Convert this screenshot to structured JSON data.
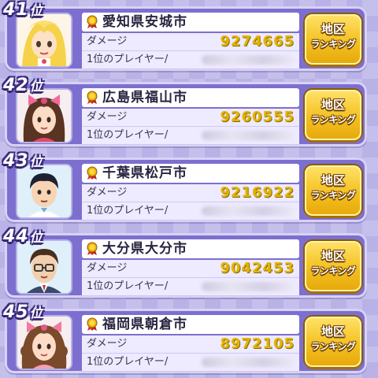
{
  "colors": {
    "background": "#b8b2e6",
    "panel": "#7d6fcf",
    "damage_value": "#e2b400",
    "button": "#f4c020"
  },
  "rankings": [
    {
      "rank_number": "41",
      "rank_suffix": "位",
      "city": "愛知県安城市",
      "damage_label": "ダメージ",
      "damage_value": "9274665",
      "top_player_label": "1位のプレイヤー/",
      "button_line1": "地区",
      "button_line2": "ランキング",
      "avatar_icon": "blonde-girl-avatar-icon"
    },
    {
      "rank_number": "42",
      "rank_suffix": "位",
      "city": "広島県福山市",
      "damage_label": "ダメージ",
      "damage_value": "9260555",
      "top_player_label": "1位のプレイヤー/",
      "button_line1": "地区",
      "button_line2": "ランキング",
      "avatar_icon": "brown-hair-girl-bow-avatar-icon"
    },
    {
      "rank_number": "43",
      "rank_suffix": "位",
      "city": "千葉県松戸市",
      "damage_label": "ダメージ",
      "damage_value": "9216922",
      "top_player_label": "1位のプレイヤー/",
      "button_line1": "地区",
      "button_line2": "ランキング",
      "avatar_icon": "dark-hair-man-avatar-icon"
    },
    {
      "rank_number": "44",
      "rank_suffix": "位",
      "city": "大分県大分市",
      "damage_label": "ダメージ",
      "damage_value": "9042453",
      "top_player_label": "1位のプレイヤー/",
      "button_line1": "地区",
      "button_line2": "ランキング",
      "avatar_icon": "man-glasses-suit-avatar-icon"
    },
    {
      "rank_number": "45",
      "rank_suffix": "位",
      "city": "福岡県朝倉市",
      "damage_label": "ダメージ",
      "damage_value": "8972105",
      "top_player_label": "1位のプレイヤー/",
      "button_line1": "地区",
      "button_line2": "ランキング",
      "avatar_icon": "curly-hair-girl-bow-avatar-icon"
    }
  ]
}
